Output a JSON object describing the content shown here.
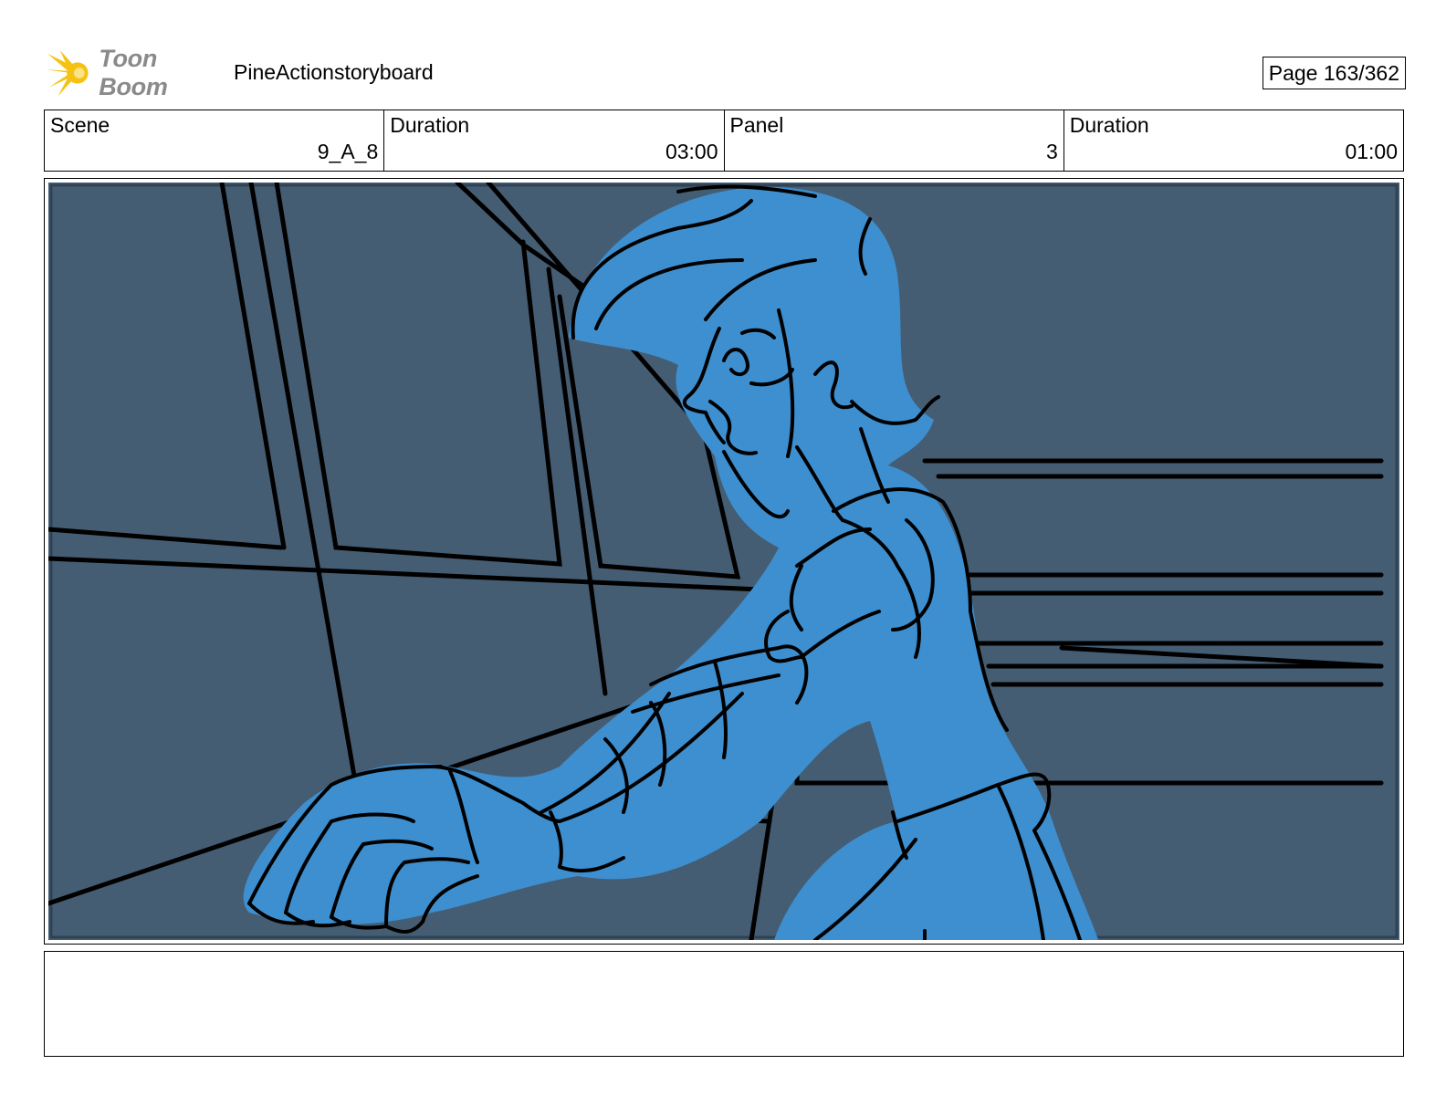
{
  "header": {
    "logo_text": "Toon Boom",
    "project_title": "PineActionstoryboard",
    "page_label": "Page 163/362"
  },
  "info": {
    "scene_label": "Scene",
    "scene_value": "9_A_8",
    "scene_duration_label": "Duration",
    "scene_duration_value": "03:00",
    "panel_label": "Panel",
    "panel_value": "3",
    "panel_duration_label": "Duration",
    "panel_duration_value": "01:00"
  },
  "colors": {
    "background_slate": "#455d73",
    "character_blue": "#3d8fd0",
    "logo_yellow": "#f5c211",
    "ink": "#000000"
  },
  "notes": {
    "text": ""
  }
}
